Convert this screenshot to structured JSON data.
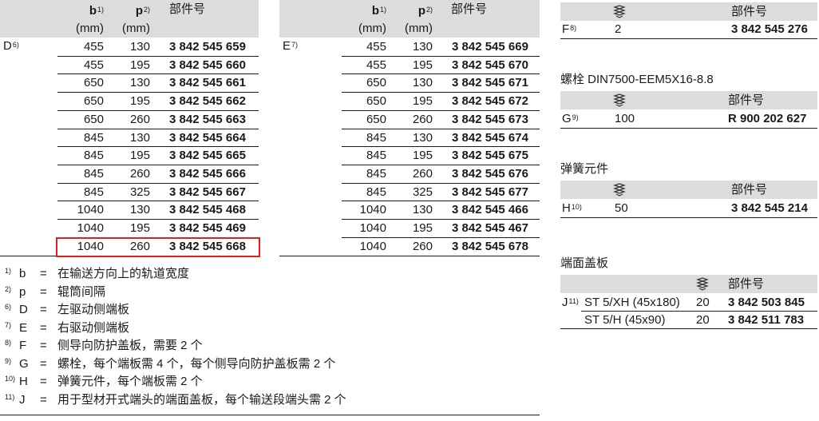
{
  "colors": {
    "header_bg": "#dcdcdc",
    "highlight": "#e02020",
    "text": "#1a1a1a"
  },
  "icons": {
    "quantity": "stacked-parts-icon"
  },
  "tableD": {
    "label": "D",
    "label_sup": "6)",
    "col_b": "b",
    "col_b_sup": "1)",
    "col_p": "p",
    "col_p_sup": "2)",
    "col_part": "部件号",
    "unit_b": "(mm)",
    "unit_p": "(mm)",
    "rows": [
      {
        "b": "455",
        "p": "130",
        "part": "3 842 545 659"
      },
      {
        "b": "455",
        "p": "195",
        "part": "3 842 545 660"
      },
      {
        "b": "650",
        "p": "130",
        "part": "3 842 545 661"
      },
      {
        "b": "650",
        "p": "195",
        "part": "3 842 545 662"
      },
      {
        "b": "650",
        "p": "260",
        "part": "3 842 545 663"
      },
      {
        "b": "845",
        "p": "130",
        "part": "3 842 545 664"
      },
      {
        "b": "845",
        "p": "195",
        "part": "3 842 545 665"
      },
      {
        "b": "845",
        "p": "260",
        "part": "3 842 545 666"
      },
      {
        "b": "845",
        "p": "325",
        "part": "3 842 545 667"
      },
      {
        "b": "1040",
        "p": "130",
        "part": "3 842 545 468"
      },
      {
        "b": "1040",
        "p": "195",
        "part": "3 842 545 469"
      },
      {
        "b": "1040",
        "p": "260",
        "part": "3 842 545 668"
      }
    ]
  },
  "tableE": {
    "label": "E",
    "label_sup": "7)",
    "col_b": "b",
    "col_b_sup": "1)",
    "col_p": "p",
    "col_p_sup": "2)",
    "col_part": "部件号",
    "unit_b": "(mm)",
    "unit_p": "(mm)",
    "rows": [
      {
        "b": "455",
        "p": "130",
        "part": "3 842 545 669"
      },
      {
        "b": "455",
        "p": "195",
        "part": "3 842 545 670"
      },
      {
        "b": "650",
        "p": "130",
        "part": "3 842 545 671"
      },
      {
        "b": "650",
        "p": "195",
        "part": "3 842 545 672"
      },
      {
        "b": "650",
        "p": "260",
        "part": "3 842 545 673"
      },
      {
        "b": "845",
        "p": "130",
        "part": "3 842 545 674"
      },
      {
        "b": "845",
        "p": "195",
        "part": "3 842 545 675"
      },
      {
        "b": "845",
        "p": "260",
        "part": "3 842 545 676"
      },
      {
        "b": "845",
        "p": "325",
        "part": "3 842 545 677"
      },
      {
        "b": "1040",
        "p": "130",
        "part": "3 842 545 466"
      },
      {
        "b": "1040",
        "p": "195",
        "part": "3 842 545 467"
      },
      {
        "b": "1040",
        "p": "260",
        "part": "3 842 545 678"
      }
    ]
  },
  "tableF": {
    "label": "F",
    "label_sup": "8)",
    "col_part": "部件号",
    "qty": "2",
    "part": "3 842 545 276"
  },
  "tableG": {
    "title": "螺栓 DIN7500-EEM5X16-8.8",
    "label": "G",
    "label_sup": "9)",
    "col_part": "部件号",
    "qty": "100",
    "part": "R 900 202 627"
  },
  "tableH": {
    "title": "弹簧元件",
    "label": "H",
    "label_sup": "10)",
    "col_part": "部件号",
    "qty": "50",
    "part": "3 842 545 214"
  },
  "tableJ": {
    "title": "端面盖板",
    "label": "J",
    "label_sup": "11)",
    "col_part": "部件号",
    "rows": [
      {
        "desc": "ST 5/XH (45x180)",
        "qty": "20",
        "part": "3 842 503 845"
      },
      {
        "desc": "ST 5/H (45x90)",
        "qty": "20",
        "part": "3 842 511 783"
      }
    ]
  },
  "footnotes": [
    {
      "num": "1)",
      "letter": "b",
      "eq": "=",
      "text": "在输送方向上的轨道宽度"
    },
    {
      "num": "2)",
      "letter": "p",
      "eq": "=",
      "text": "辊筒间隔"
    },
    {
      "num": "6)",
      "letter": "D",
      "eq": "=",
      "text": "左驱动侧端板"
    },
    {
      "num": "7)",
      "letter": "E",
      "eq": "=",
      "text": "右驱动侧端板"
    },
    {
      "num": "8)",
      "letter": "F",
      "eq": "=",
      "text": "侧导向防护盖板，需要 2 个"
    },
    {
      "num": "9)",
      "letter": "G",
      "eq": "=",
      "text": "螺栓，每个端板需 4 个，每个侧导向防护盖板需 2 个"
    },
    {
      "num": "10)",
      "letter": "H",
      "eq": "=",
      "text": "弹簧元件，每个端板需 2 个"
    },
    {
      "num": "11)",
      "letter": "J",
      "eq": "=",
      "text": "用于型材开式端头的端面盖板，每个输送段端头需 2 个"
    }
  ]
}
